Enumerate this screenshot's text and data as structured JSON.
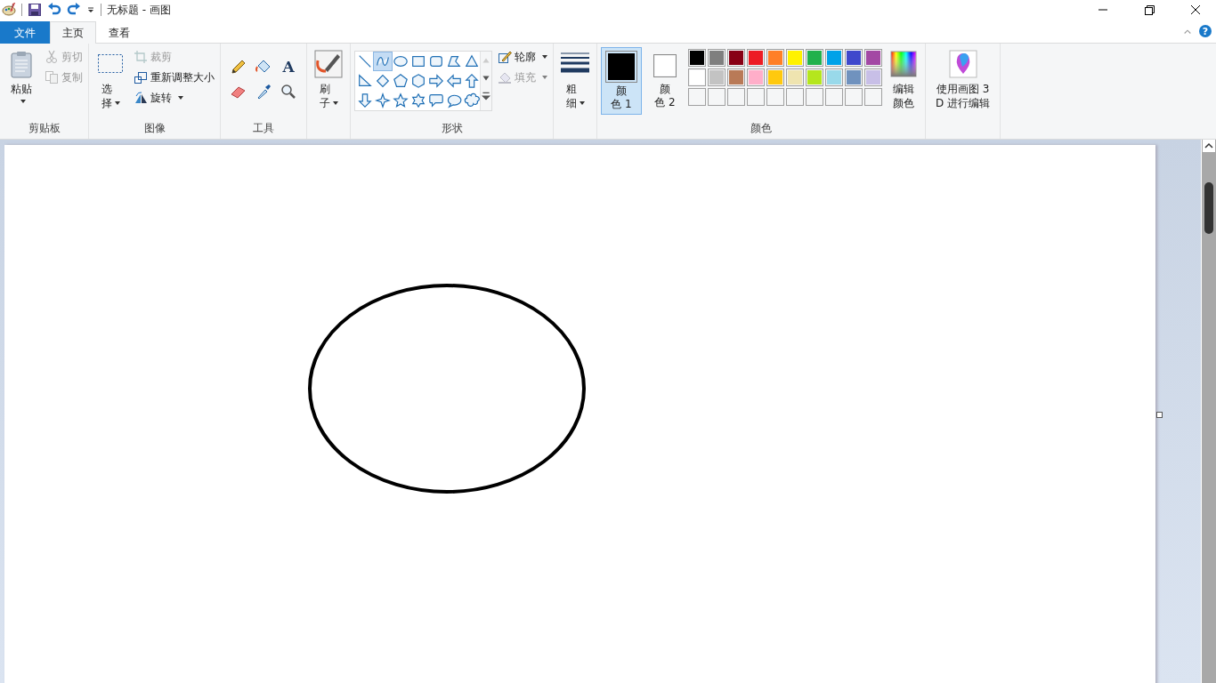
{
  "window": {
    "title": "无标题 - 画图",
    "help": "?"
  },
  "tabs": [
    {
      "label": "文件",
      "kind": "file",
      "selected": false
    },
    {
      "label": "主页",
      "kind": "tab",
      "selected": true
    },
    {
      "label": "查看",
      "kind": "tab",
      "selected": false
    }
  ],
  "clipboard": {
    "paste": "粘贴",
    "cut": {
      "label": "剪切",
      "disabled": true
    },
    "copy": {
      "label": "复制",
      "disabled": true
    },
    "group_label": "剪贴板"
  },
  "image": {
    "select": "选择",
    "crop": {
      "label": "裁剪",
      "disabled": true
    },
    "resize": "重新调整大小",
    "rotate": "旋转",
    "group_label": "图像"
  },
  "tools": {
    "text_tool": "A",
    "group_label": "工具"
  },
  "brushes": {
    "label": "刷子"
  },
  "shapes": {
    "items": [
      {
        "kind": "line",
        "selected": false
      },
      {
        "kind": "curve",
        "selected": true
      },
      {
        "kind": "oval",
        "selected": false
      },
      {
        "kind": "rectangle",
        "selected": false
      },
      {
        "kind": "rounded-rectangle",
        "selected": false
      },
      {
        "kind": "polygon",
        "selected": false
      },
      {
        "kind": "triangle",
        "selected": false
      },
      {
        "kind": "right-triangle",
        "selected": false
      },
      {
        "kind": "diamond",
        "selected": false
      },
      {
        "kind": "pentagon",
        "selected": false
      },
      {
        "kind": "hexagon",
        "selected": false
      },
      {
        "kind": "right-arrow",
        "selected": false
      },
      {
        "kind": "left-arrow",
        "selected": false
      },
      {
        "kind": "up-arrow",
        "selected": false
      },
      {
        "kind": "down-arrow",
        "selected": false
      },
      {
        "kind": "four-point-star",
        "selected": false
      },
      {
        "kind": "five-point-star",
        "selected": false
      },
      {
        "kind": "six-point-star",
        "selected": false
      },
      {
        "kind": "rounded-callout",
        "selected": false
      },
      {
        "kind": "oval-callout",
        "selected": false
      },
      {
        "kind": "cloud-callout",
        "selected": false
      }
    ],
    "outline": {
      "label": "轮廓",
      "disabled": false
    },
    "fill": {
      "label": "填充",
      "disabled": true
    },
    "group_label": "形状"
  },
  "size": {
    "label": "粗细"
  },
  "colors": {
    "color1": {
      "label": "颜色 1",
      "color": "#000000",
      "selected": true
    },
    "color2": {
      "label": "颜色 2",
      "color": "#ffffff",
      "selected": false
    },
    "palette": [
      {
        "color": "#000000"
      },
      {
        "color": "#7f7f7f"
      },
      {
        "color": "#880015"
      },
      {
        "color": "#ed1c24"
      },
      {
        "color": "#ff7f27"
      },
      {
        "color": "#fff200"
      },
      {
        "color": "#22b14c"
      },
      {
        "color": "#00a2e8"
      },
      {
        "color": "#3f48cc"
      },
      {
        "color": "#a349a4"
      },
      {
        "color": "#ffffff"
      },
      {
        "color": "#c3c3c3"
      },
      {
        "color": "#b97a57"
      },
      {
        "color": "#ffaec9"
      },
      {
        "color": "#ffc90e"
      },
      {
        "color": "#efe4b0"
      },
      {
        "color": "#b5e61d"
      },
      {
        "color": "#99d9ea"
      },
      {
        "color": "#7092be"
      },
      {
        "color": "#c8bfe7"
      }
    ],
    "edit": "编辑颜色",
    "group_label": "颜色"
  },
  "paint3d": {
    "label": "使用画图 3D 进行编辑"
  }
}
